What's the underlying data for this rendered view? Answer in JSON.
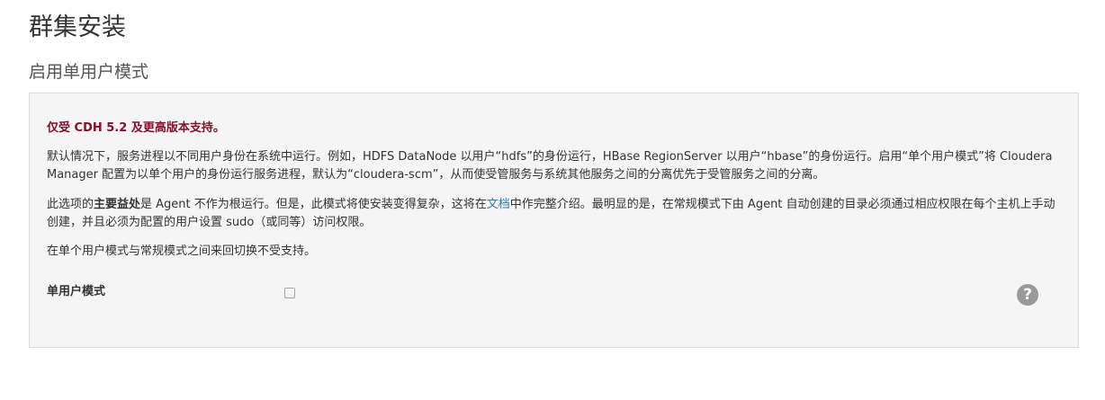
{
  "page": {
    "title": "群集安装",
    "subtitle": "启用单用户模式"
  },
  "panel": {
    "warning": "仅受 CDH 5.2 及更高版本支持。",
    "paragraph1": "默认情况下，服务进程以不同用户身份在系统中运行。例如，HDFS DataNode 以用户“hdfs”的身份运行，HBase RegionServer 以用户“hbase”的身份运行。启用“单个用户模式”将 Cloudera Manager 配置为以单个用户的身份运行服务进程，默认为“cloudera-scm”，从而使受管服务与系统其他服务之间的分离优先于受管服务之间的分离。",
    "paragraph2_prefix": "此选项的",
    "paragraph2_bold": "主要益处",
    "paragraph2_mid": "是 Agent 不作为根运行。但是，此模式将使安装变得复杂，这将在",
    "paragraph2_link": "文档",
    "paragraph2_suffix": "中作完整介绍。最明显的是，在常规模式下由 Agent 自动创建的目录必须通过相应权限在每个主机上手动创建，并且必须为配置的用户设置 sudo（或同等）访问权限。",
    "paragraph3": "在单个用户模式与常规模式之间来回切换不受支持。",
    "field_label": "单用户模式",
    "checkbox_checked": false,
    "help_icon": "question-circle-icon",
    "help_glyph": "?"
  },
  "colors": {
    "warning": "#8b0d27",
    "link": "#2a7ab3",
    "panel_bg": "#f5f5f5",
    "help_icon_bg": "#999999"
  }
}
